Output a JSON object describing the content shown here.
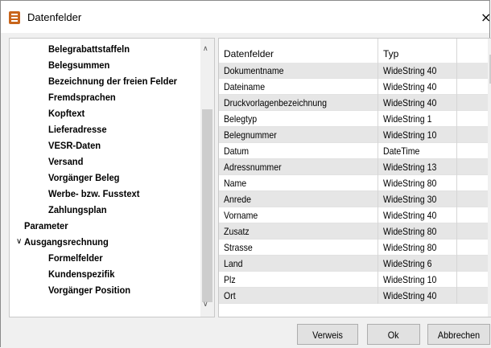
{
  "window": {
    "title": "Datenfelder",
    "close_glyph": "×"
  },
  "tree": {
    "items": [
      {
        "label": "Belegrabattstaffeln",
        "level": 2
      },
      {
        "label": "Belegsummen",
        "level": 2
      },
      {
        "label": "Bezeichnung der freien Felder",
        "level": 2
      },
      {
        "label": "Fremdsprachen",
        "level": 2
      },
      {
        "label": "Kopftext",
        "level": 2
      },
      {
        "label": "Lieferadresse",
        "level": 2
      },
      {
        "label": "VESR-Daten",
        "level": 2
      },
      {
        "label": "Versand",
        "level": 2
      },
      {
        "label": "Vorgänger Beleg",
        "level": 2
      },
      {
        "label": "Werbe- bzw. Fusstext",
        "level": 2
      },
      {
        "label": "Zahlungsplan",
        "level": 2
      },
      {
        "label": "Parameter",
        "level": 1
      },
      {
        "label": "Ausgangsrechnung",
        "level": 1,
        "expanded": true,
        "toggle": "∨"
      },
      {
        "label": "Formelfelder",
        "level": 2
      },
      {
        "label": "Kundenspezifik",
        "level": 2
      },
      {
        "label": "Vorgänger Position",
        "level": 2
      }
    ]
  },
  "grid": {
    "columns": [
      "Datenfelder",
      "Typ"
    ],
    "rows": [
      [
        "Dokumentname",
        "WideString  40"
      ],
      [
        "Dateiname",
        "WideString  40"
      ],
      [
        "Druckvorlagenbezeichnung",
        "WideString  40"
      ],
      [
        "Belegtyp",
        "WideString  1"
      ],
      [
        "Belegnummer",
        "WideString  10"
      ],
      [
        "Datum",
        "DateTime"
      ],
      [
        "Adressnummer",
        "WideString  13"
      ],
      [
        "Name",
        "WideString  80"
      ],
      [
        "Anrede",
        "WideString  30"
      ],
      [
        "Vorname",
        "WideString  40"
      ],
      [
        "Zusatz",
        "WideString  80"
      ],
      [
        "Strasse",
        "WideString  80"
      ],
      [
        "Land",
        "WideString  6"
      ],
      [
        "Plz",
        "WideString  10"
      ],
      [
        "Ort",
        "WideString  40"
      ]
    ]
  },
  "buttons": {
    "verweis": "Verweis",
    "ok": "Ok",
    "abbrechen": "Abbrechen"
  },
  "icons": {
    "window": "app-document-icon",
    "scroll_up": "▲",
    "scroll_down": "▼"
  }
}
